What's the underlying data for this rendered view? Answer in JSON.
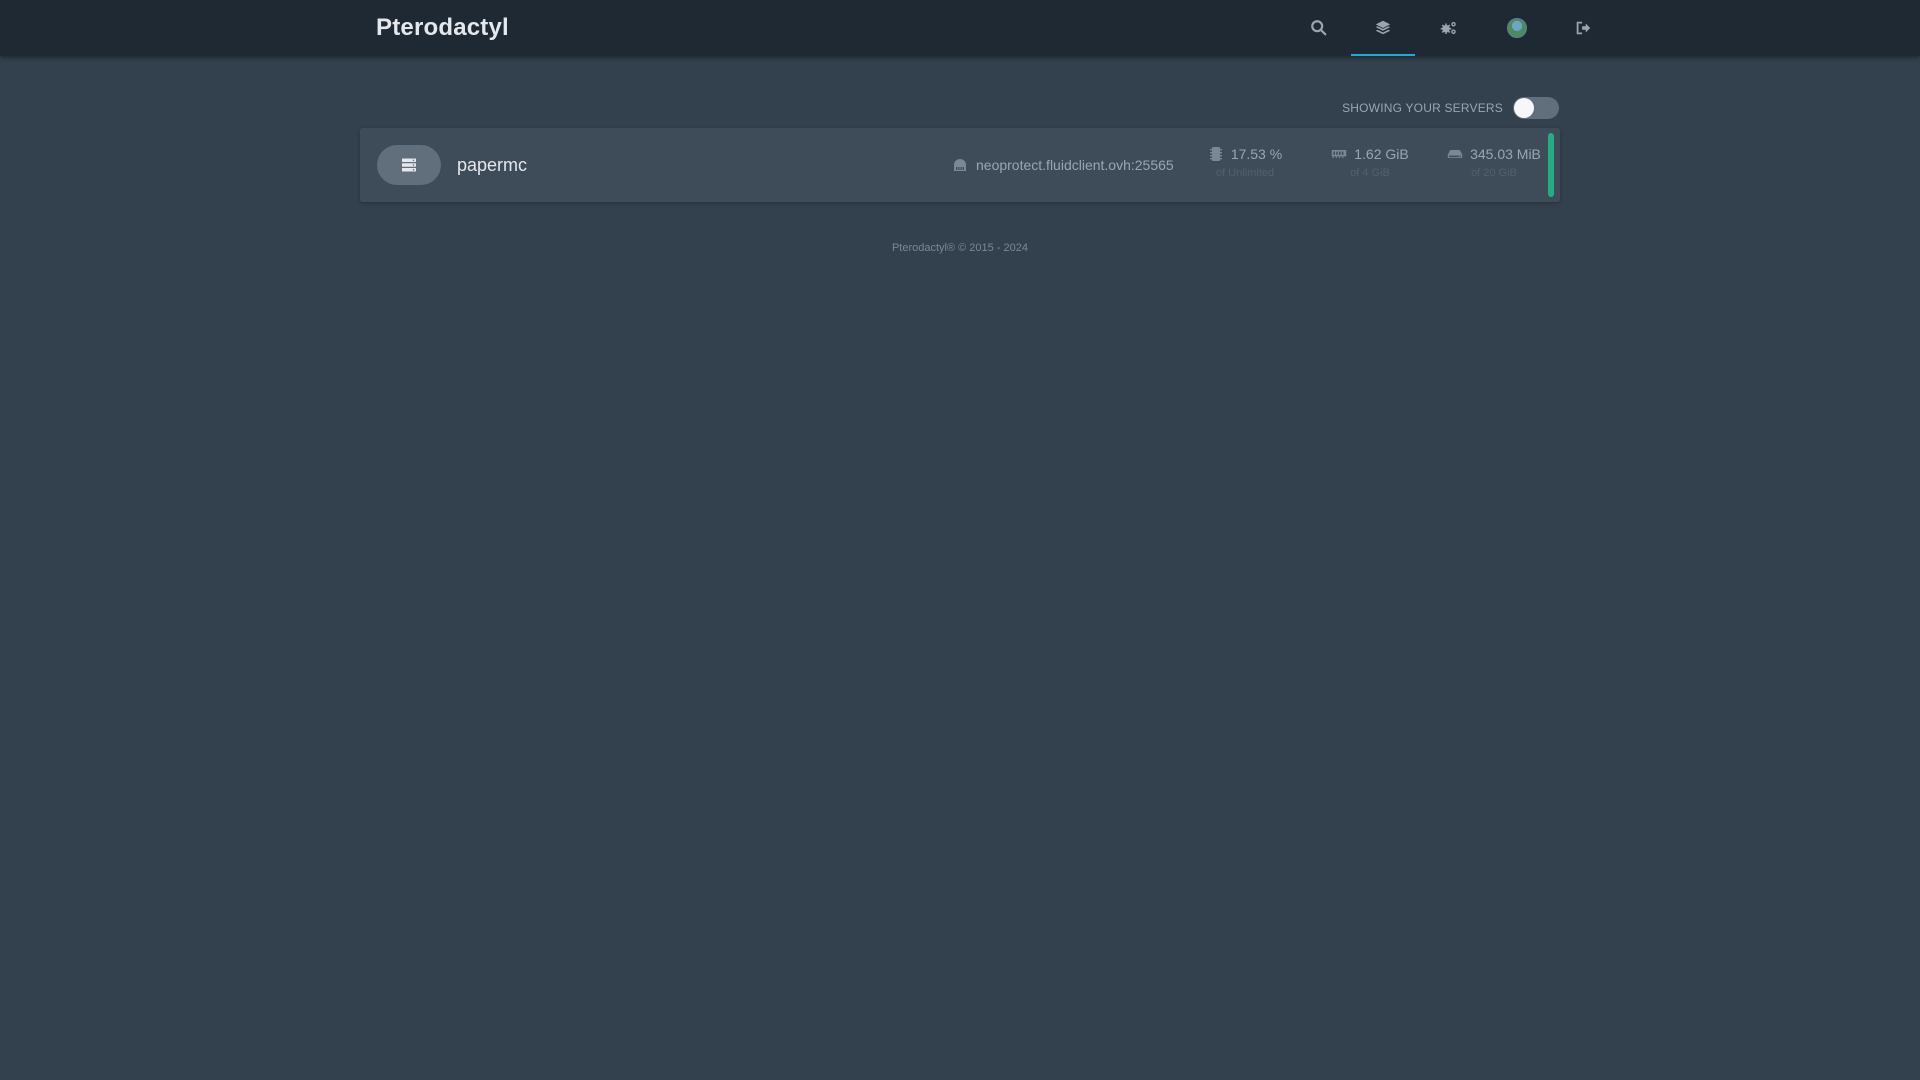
{
  "header": {
    "brand": "Pterodactyl",
    "nav": [
      {
        "icon": "search-icon"
      },
      {
        "icon": "layers-icon",
        "active": true
      },
      {
        "icon": "cogs-icon"
      },
      {
        "icon": "avatar"
      },
      {
        "icon": "sign-out-icon"
      }
    ]
  },
  "filter": {
    "label": "Showing your servers",
    "toggle_on": false
  },
  "servers": [
    {
      "name": "papermc",
      "address": "neoprotect.fluidclient.ovh:25565",
      "cpu": {
        "value": "17.53 %",
        "limit": "of Unlimited"
      },
      "memory": {
        "value": "1.62 GiB",
        "limit": "of 4 GiB"
      },
      "disk": {
        "value": "345.03 MiB",
        "limit": "of 20 GiB"
      },
      "status_color": "#27ab83"
    }
  ],
  "footer": {
    "text": "Pterodactyl® © 2015 - 2024"
  },
  "colors": {
    "background": "#33404d",
    "navbar": "#1f2933",
    "row": "#3e4c59",
    "accent": "#22a9d6",
    "status_online": "#27ab83"
  }
}
